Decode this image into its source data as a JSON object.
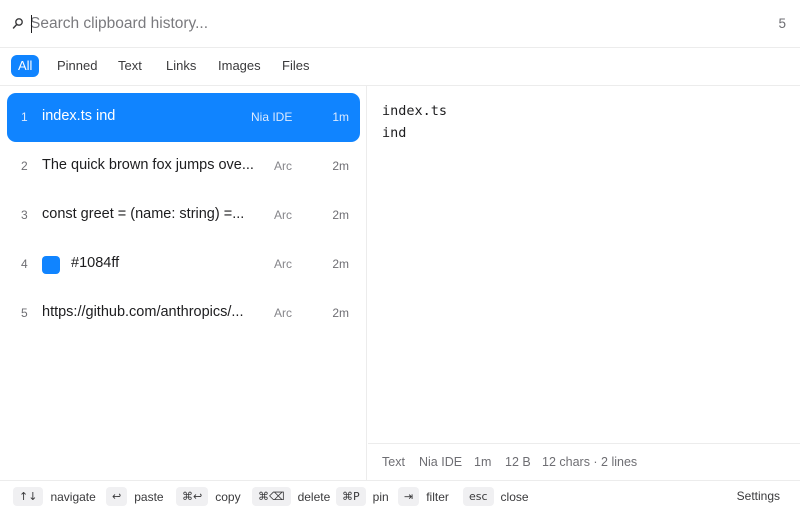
{
  "search": {
    "placeholder": "Search clipboard history...",
    "value": "",
    "count": "5",
    "icon": "search-icon"
  },
  "filters": [
    "All",
    "Pinned",
    "Text",
    "Links",
    "Images",
    "Files"
  ],
  "active_filter": "All",
  "items": [
    {
      "index": "1",
      "preview": "index.ts ind",
      "app": "Nia IDE",
      "time": "1m",
      "selected": true
    },
    {
      "index": "2",
      "preview": "The quick brown fox jumps ove...",
      "app": "Arc",
      "time": "2m"
    },
    {
      "index": "3",
      "preview": "const greet = (name: string) =...",
      "app": "Arc",
      "time": "2m"
    },
    {
      "index": "4",
      "preview": "#1084ff",
      "app": "Arc",
      "time": "2m",
      "swatch_color": "#1084ff"
    },
    {
      "index": "5",
      "preview": "https://github.com/anthropics/...",
      "app": "Arc",
      "time": "2m"
    }
  ],
  "detail": {
    "content": "index.ts\nind",
    "meta": {
      "type": "Text",
      "app": "Nia IDE",
      "time": "1m",
      "size": "12 B",
      "stats": "12 chars · 2 lines"
    }
  },
  "footer": {
    "hints": [
      {
        "key": "↑↓",
        "label": "navigate"
      },
      {
        "key": "↩",
        "label": "paste"
      },
      {
        "key": "⌘↩",
        "label": "copy"
      },
      {
        "key": "⌘⌫",
        "label": "delete"
      },
      {
        "key": "⌘P",
        "label": "pin"
      },
      {
        "key": "⇥",
        "label": "filter"
      },
      {
        "key": "esc",
        "label": "close"
      }
    ],
    "settings_label": "Settings"
  },
  "colors": {
    "accent": "#1084ff",
    "divider": "#ececec",
    "muted_text": "#6e6e73"
  }
}
